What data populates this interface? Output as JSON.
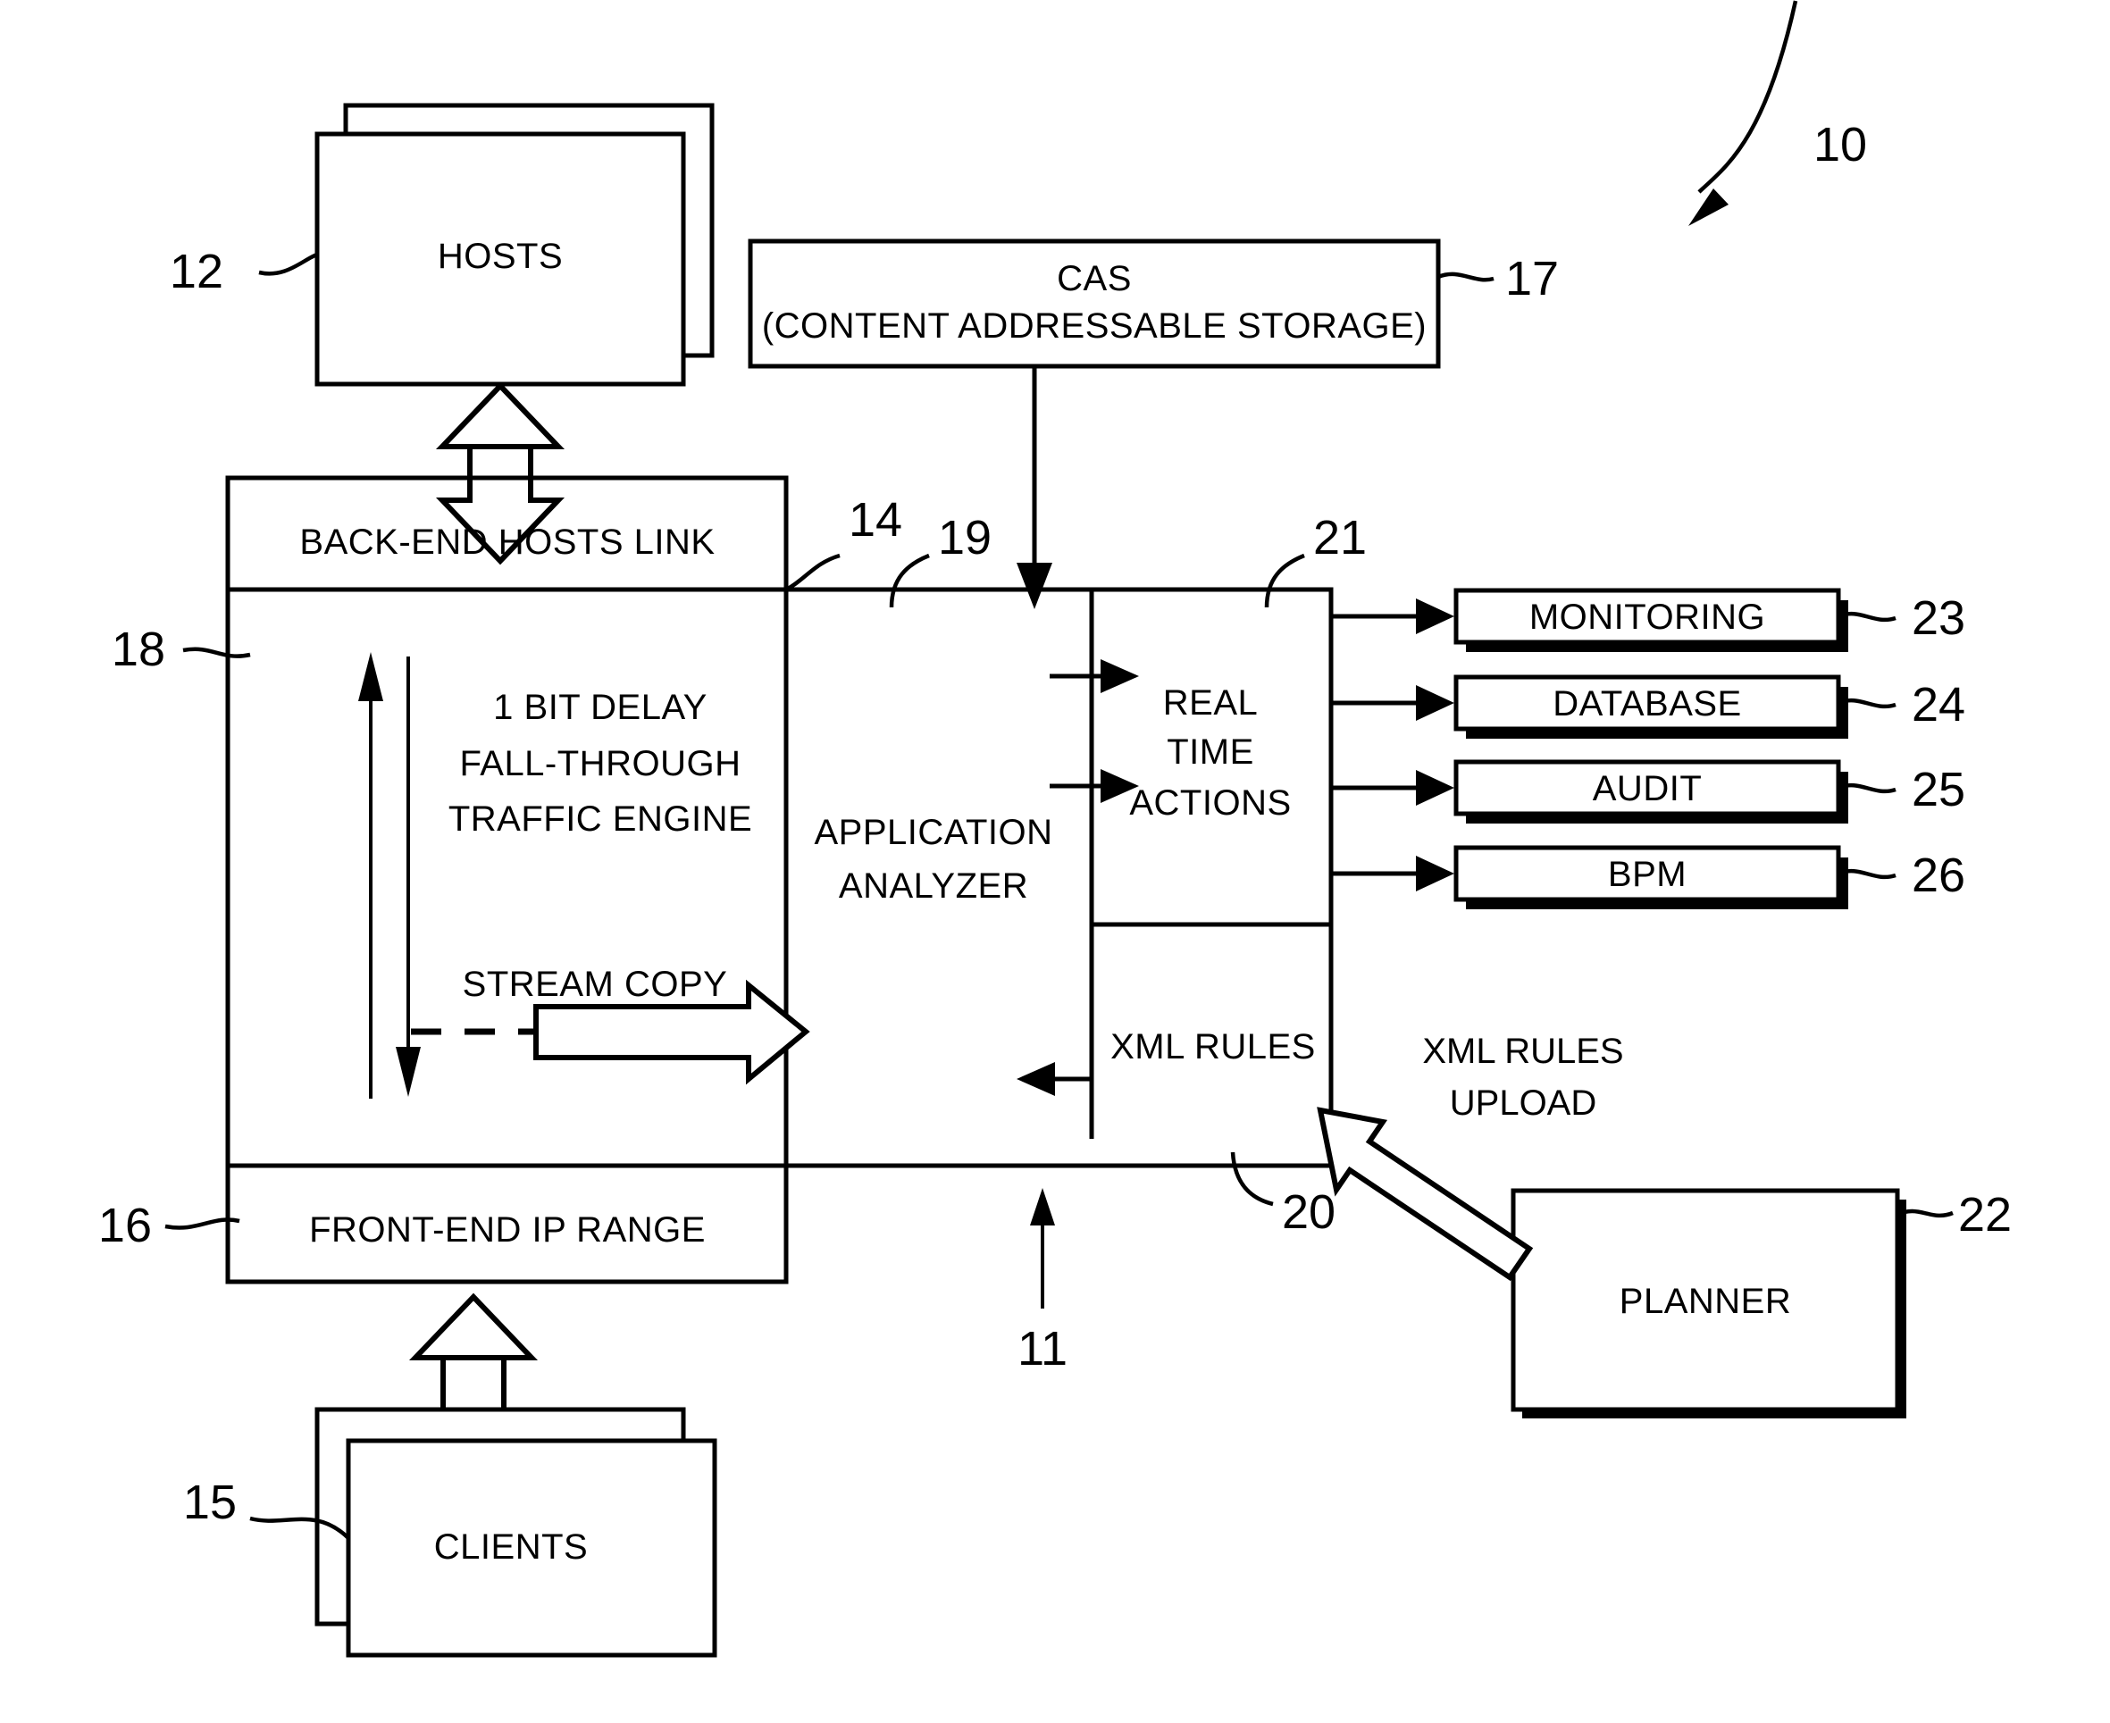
{
  "figure": {
    "number": "10",
    "title": "",
    "type": "patent-block-diagram"
  },
  "blocks": {
    "hosts": {
      "label": "HOSTS",
      "ref": "12"
    },
    "cas": {
      "line1": "CAS",
      "line2": "(CONTENT ADDRESSABLE STORAGE)",
      "ref": "17"
    },
    "back_end_hosts_link": {
      "label": "BACK-END HOSTS LINK",
      "ref": "14"
    },
    "traffic_engine": {
      "line1": "1 BIT DELAY",
      "line2": "FALL-THROUGH",
      "line3": "TRAFFIC ENGINE",
      "ref": "18"
    },
    "stream_copy": {
      "label": "STREAM COPY"
    },
    "application_analyzer": {
      "line1": "APPLICATION",
      "line2": "ANALYZER",
      "ref": "19"
    },
    "real_time_actions": {
      "line1": "REAL",
      "line2": "TIME",
      "line3": "ACTIONS",
      "ref": "21"
    },
    "xml_rules": {
      "label": "XML RULES",
      "ref": "20"
    },
    "front_end_ip_range": {
      "label": "FRONT-END IP RANGE",
      "ref": "16"
    },
    "clients": {
      "label": "CLIENTS",
      "ref": "15"
    },
    "planner": {
      "label": "PLANNER",
      "ref": "22"
    },
    "system": {
      "ref": "11"
    }
  },
  "outputs": [
    {
      "label": "MONITORING",
      "ref": "23"
    },
    {
      "label": "DATABASE",
      "ref": "24"
    },
    {
      "label": "AUDIT",
      "ref": "25"
    },
    {
      "label": "BPM",
      "ref": "26"
    }
  ],
  "annotations": {
    "xml_rules_upload": {
      "line1": "XML RULES",
      "line2": "UPLOAD"
    }
  },
  "colors": {
    "ink": "#000000",
    "paper": "#ffffff"
  }
}
